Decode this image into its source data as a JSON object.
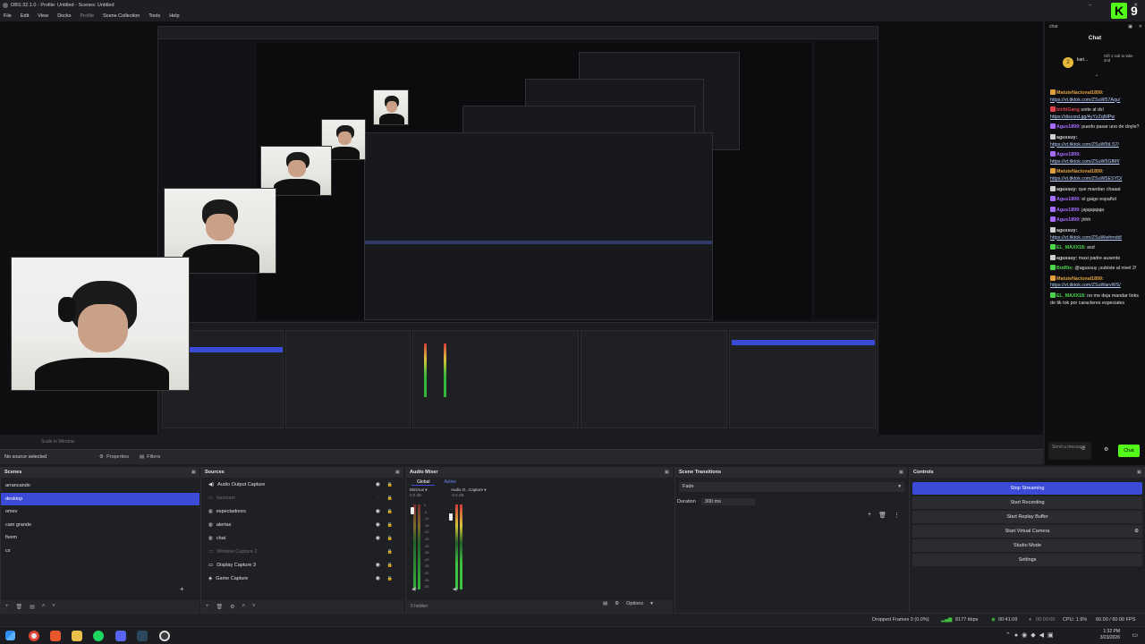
{
  "window": {
    "title": "OBS 32.1.0 - Profile: Untitled - Scenes: Untitled",
    "controls": [
      "–",
      "□",
      "✕"
    ]
  },
  "menu": [
    {
      "label": "File",
      "dim": false
    },
    {
      "label": "Edit",
      "dim": false
    },
    {
      "label": "View",
      "dim": false
    },
    {
      "label": "Docks",
      "dim": false
    },
    {
      "label": "Profile",
      "dim": true
    },
    {
      "label": "Scene Collection",
      "dim": false
    },
    {
      "label": "Tools",
      "dim": false
    },
    {
      "label": "Help",
      "dim": false
    }
  ],
  "preview": {
    "zoom_text": "Scale to Window"
  },
  "properties_bar": {
    "no_source": "No source selected",
    "properties": "Properties",
    "filters": "Filters"
  },
  "scenes": {
    "title": "Scenes",
    "items": [
      {
        "label": "arrancando",
        "selected": false
      },
      {
        "label": "desktop",
        "selected": true
      },
      {
        "label": "omev",
        "selected": false
      },
      {
        "label": "cam grande",
        "selected": false
      },
      {
        "label": "fivem",
        "selected": false
      },
      {
        "label": "cs",
        "selected": false
      }
    ]
  },
  "sources": {
    "title": "Sources",
    "items": [
      {
        "label": "Audio Output Capture",
        "hidden": false
      },
      {
        "label": "facecam",
        "hidden": true
      },
      {
        "label": "espectadores",
        "hidden": false
      },
      {
        "label": "alertas",
        "hidden": false
      },
      {
        "label": "chat",
        "hidden": false
      },
      {
        "label": "Window Capture 2",
        "hidden": true
      },
      {
        "label": "Display Capture 3",
        "hidden": false
      },
      {
        "label": "Game Capture",
        "hidden": false
      }
    ]
  },
  "mixer": {
    "title": "Audio Mixer",
    "tab_global": "Global",
    "tab_active": "Active",
    "channels": [
      {
        "name": "Mic/Aux",
        "db": "0.0 dB"
      },
      {
        "name": "Audio O...Capture",
        "db": "-2.5 dB"
      }
    ],
    "hidden_text": "0 hidden",
    "scale": [
      "0",
      "-5",
      "-10",
      "-15",
      "-20",
      "-25",
      "-30",
      "-35",
      "-40",
      "-45",
      "-50",
      "-55",
      "-60"
    ]
  },
  "transitions": {
    "title": "Scene Transitions",
    "type": "Fade",
    "duration_label": "Duration",
    "duration_value": "300 ms"
  },
  "controls": {
    "title": "Controls",
    "buttons": [
      {
        "label": "Stop Streaming",
        "active": true
      },
      {
        "label": "Start Recording",
        "active": false
      },
      {
        "label": "Start Replay Buffer",
        "active": false
      },
      {
        "label": "Start Virtual Camera",
        "active": false
      },
      {
        "label": "Studio Mode",
        "active": false
      },
      {
        "label": "Settings",
        "active": false
      }
    ]
  },
  "footer": {
    "options_label": "Options"
  },
  "status": {
    "dropped": "Dropped Frames 0 (0.0%)",
    "kbps": "8177 kbps",
    "live_time": "00:41:09",
    "rec_time": "00:00:00",
    "cpu": "CPU: 1.9%",
    "fps": "60.00 / 60.00 FPS"
  },
  "taskbar": {
    "time": "1:32 PM",
    "date": "3/23/2026"
  },
  "chat": {
    "header": "chat",
    "title": "Chat",
    "pinned": {
      "user": "kari...",
      "text": "Gift 1 sub to take 2nd",
      "badge_number": "2"
    },
    "messages": [
      {
        "user": "MatuteNacional1899:",
        "color": "#e0a13a",
        "text": "",
        "link": "https://vt.tiktok.com/ZSuW57Aqu/"
      },
      {
        "user": "bichiGang",
        "color": "#e2424c",
        "text": "unite al ds!",
        "link": "https://discord.gg/4yYzZqNlPw"
      },
      {
        "user": "Agus1899:",
        "color": "#a66bff",
        "text": "puedo pasar uno de doyle?",
        "link": ""
      },
      {
        "user": "agussuy:",
        "color": "#d0d0d0",
        "text": "",
        "link": "https://vt.tiktok.com/ZSuW5tLS7/"
      },
      {
        "user": "Agus1899:",
        "color": "#a66bff",
        "text": "",
        "link": "https://vt.tiktok.com/ZSuW5GfMf/"
      },
      {
        "user": "MatuteNacional1899:",
        "color": "#e0a13a",
        "text": "",
        "link": "https://vt.tiktok.com/ZSuW5ESYD/"
      },
      {
        "user": "agussuy:",
        "color": "#d0d0d0",
        "text": "que mandan chaaat",
        "link": ""
      },
      {
        "user": "Agus1899:",
        "color": "#a66bff",
        "text": "el gaigo español",
        "link": ""
      },
      {
        "user": "Agus1899:",
        "color": "#a66bff",
        "text": "jajajajajaja",
        "link": ""
      },
      {
        "user": "Agus1899:",
        "color": "#a66bff",
        "text": "jhhh",
        "link": ""
      },
      {
        "user": "agussuy:",
        "color": "#d0d0d0",
        "text": "",
        "link": "https://vt.tiktok.com/ZSuWwhmdd/"
      },
      {
        "user": "EL_MAXX18:",
        "color": "#4ad64a",
        "text": "asd",
        "link": ""
      },
      {
        "user": "agussuy:",
        "color": "#d0d0d0",
        "text": "maxi padre ausente",
        "link": ""
      },
      {
        "user": "BotRix:",
        "color": "#4ad64a",
        "text": "@agussuy ¡subiste al nivel 2!",
        "link": ""
      },
      {
        "user": "MatuteNacional1899:",
        "color": "#e0a13a",
        "text": "",
        "link": "https://vt.tiktok.com/ZSuWarvWS/"
      },
      {
        "user": "EL_MAXX18:",
        "color": "#4ad64a",
        "text": "no me deja mandar links de tik tok por caracteres especiales",
        "link": ""
      }
    ],
    "input_placeholder": "Send a message",
    "send_label": "Chat"
  },
  "overlay": {
    "logo_letter": "K",
    "count": "9"
  },
  "colors": {
    "accent": "#3c4ad8",
    "kick_green": "#53fc18",
    "bg": "#1f2024"
  }
}
